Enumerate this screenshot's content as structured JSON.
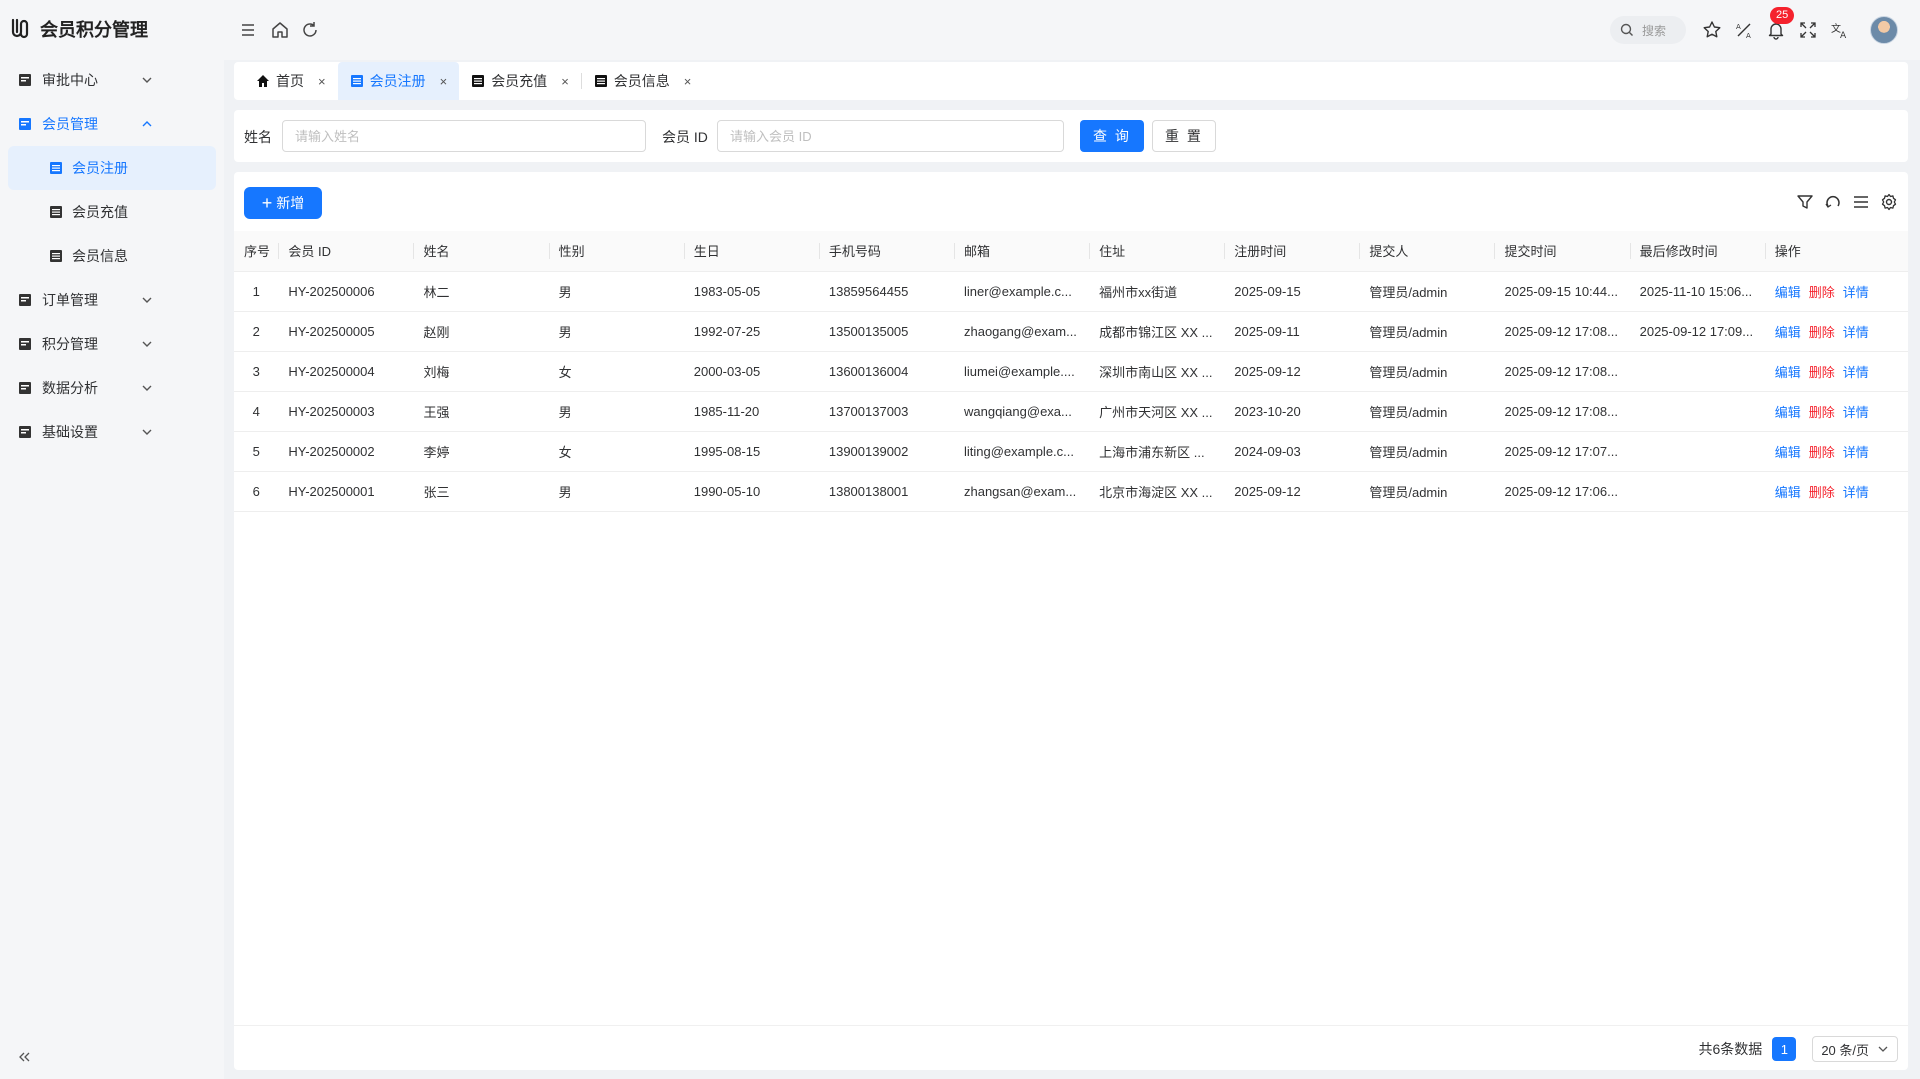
{
  "app": {
    "title": "会员积分管理"
  },
  "sidebar": {
    "items": [
      {
        "label": "审批中心",
        "icon": "approval-icon",
        "expanded": false
      },
      {
        "label": "会员管理",
        "icon": "member-icon",
        "expanded": true,
        "children": [
          {
            "label": "会员注册",
            "active": true
          },
          {
            "label": "会员充值",
            "active": false
          },
          {
            "label": "会员信息",
            "active": false
          }
        ]
      },
      {
        "label": "订单管理",
        "icon": "order-icon",
        "expanded": false
      },
      {
        "label": "积分管理",
        "icon": "points-icon",
        "expanded": false
      },
      {
        "label": "数据分析",
        "icon": "analytics-icon",
        "expanded": false
      },
      {
        "label": "基础设置",
        "icon": "settings-icon",
        "expanded": false
      }
    ]
  },
  "header": {
    "search_placeholder": "搜索",
    "notification_count": "25"
  },
  "tabs": [
    {
      "label": "首页",
      "icon": "home-icon",
      "active": false,
      "close": "×"
    },
    {
      "label": "会员注册",
      "icon": "list-icon",
      "active": true,
      "close": "×"
    },
    {
      "label": "会员充值",
      "icon": "list-icon",
      "active": false,
      "close": "×"
    },
    {
      "label": "会员信息",
      "icon": "list-icon",
      "active": false,
      "close": "×"
    }
  ],
  "filters": {
    "name_label": "姓名",
    "name_placeholder": "请输入姓名",
    "member_id_label": "会员 ID",
    "member_id_placeholder": "请输入会员 ID",
    "query_label": "查 询",
    "reset_label": "重 置"
  },
  "toolbar": {
    "add_label": "新增"
  },
  "table": {
    "columns": [
      "序号",
      "会员 ID",
      "姓名",
      "性别",
      "生日",
      "手机号码",
      "邮箱",
      "住址",
      "注册时间",
      "提交人",
      "提交时间",
      "最后修改时间",
      "操作"
    ],
    "actions": {
      "edit": "编辑",
      "delete": "删除",
      "detail": "详情"
    },
    "rows": [
      [
        "1",
        "HY-202500006",
        "林二",
        "男",
        "1983-05-05",
        "13859564455",
        "liner@example.c...",
        "福州市xx街道",
        "2025-09-15",
        "管理员/admin",
        "2025-09-15 10:44...",
        "2025-11-10 15:06..."
      ],
      [
        "2",
        "HY-202500005",
        "赵刚",
        "男",
        "1992-07-25",
        "13500135005",
        "zhaogang@exam...",
        "成都市锦江区 XX ...",
        "2025-09-11",
        "管理员/admin",
        "2025-09-12 17:08...",
        "2025-09-12 17:09..."
      ],
      [
        "3",
        "HY-202500004",
        "刘梅",
        "女",
        "2000-03-05",
        "13600136004",
        "liumei@example....",
        "深圳市南山区 XX ...",
        "2025-09-12",
        "管理员/admin",
        "2025-09-12 17:08...",
        ""
      ],
      [
        "4",
        "HY-202500003",
        "王强",
        "男",
        "1985-11-20",
        "13700137003",
        "wangqiang@exa...",
        "广州市天河区 XX ...",
        "2023-10-20",
        "管理员/admin",
        "2025-09-12 17:08...",
        ""
      ],
      [
        "5",
        "HY-202500002",
        "李婷",
        "女",
        "1995-08-15",
        "13900139002",
        "liting@example.c...",
        "上海市浦东新区 ...",
        "2024-09-03",
        "管理员/admin",
        "2025-09-12 17:07...",
        ""
      ],
      [
        "6",
        "HY-202500001",
        "张三",
        "男",
        "1990-05-10",
        "13800138001",
        "zhangsan@exam...",
        "北京市海淀区 XX ...",
        "2025-09-12",
        "管理员/admin",
        "2025-09-12 17:06...",
        ""
      ]
    ]
  },
  "pagination": {
    "total_text": "共6条数据",
    "current_page": "1",
    "page_size": "20 条/页"
  },
  "colors": {
    "primary": "#1677ff",
    "danger": "#f5222d"
  }
}
